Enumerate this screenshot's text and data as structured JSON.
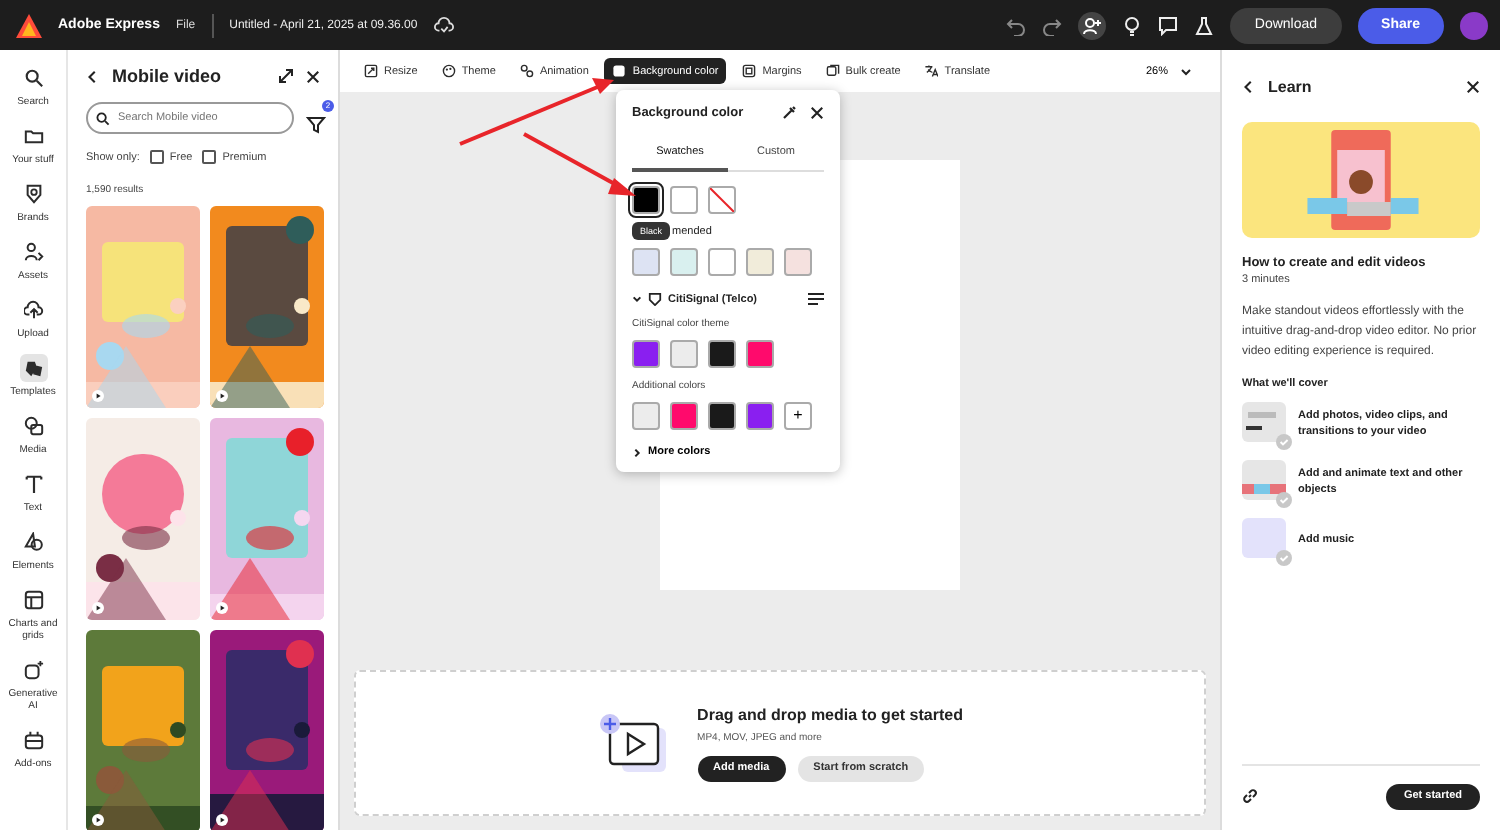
{
  "app_bar": {
    "app_name": "Adobe Express",
    "menu": "File",
    "doc_title": "Untitled - April 21, 2025 at 09.36.00",
    "buttons": [
      {
        "label": "Download",
        "kind": "secondary"
      },
      {
        "label": "Share",
        "kind": "primary"
      }
    ]
  },
  "rail": [
    {
      "label": "Search",
      "selected": false
    },
    {
      "label": "Your stuff",
      "selected": false
    },
    {
      "label": "Brands",
      "selected": false
    },
    {
      "label": "Assets",
      "selected": false
    },
    {
      "label": "Upload",
      "selected": false
    },
    {
      "label": "Templates",
      "selected": true
    },
    {
      "label": "Media",
      "selected": false
    },
    {
      "label": "Text",
      "selected": false
    },
    {
      "label": "Elements",
      "selected": false
    },
    {
      "label": "Charts and grids",
      "selected": false
    },
    {
      "label": "Generative AI",
      "selected": false
    },
    {
      "label": "Add-ons",
      "selected": false
    }
  ],
  "panel": {
    "title": "Mobile video",
    "search": {
      "placeholder": "Search Mobile video"
    },
    "filter_badge": "2",
    "show_only": "Show only:",
    "filters": [
      {
        "label": "Free",
        "checked": false
      },
      {
        "label": "Premium",
        "checked": false
      }
    ],
    "results": "1,590 results"
  },
  "toolbar": {
    "tools": [
      {
        "label": "Resize",
        "selected": false
      },
      {
        "label": "Theme",
        "selected": false
      },
      {
        "label": "Animation",
        "selected": false
      },
      {
        "label": "Background color",
        "selected": true
      },
      {
        "label": "Margins",
        "selected": false
      },
      {
        "label": "Bulk create",
        "selected": false
      },
      {
        "label": "Translate",
        "selected": false
      }
    ],
    "zoom": "26%"
  },
  "popover": {
    "title": "Background color",
    "tabs": [
      {
        "label": "Swatches",
        "selected": true
      },
      {
        "label": "Custom",
        "selected": false
      }
    ],
    "swatches": [
      {
        "kind": "color",
        "color": "#000000",
        "selected": true
      },
      {
        "kind": "color",
        "color": "#ffffff",
        "selected": false
      },
      {
        "kind": "none",
        "selected": false
      }
    ],
    "tooltip": "Black",
    "recommended_label": "mended",
    "recommended": [
      {
        "color": "#dde3f3"
      },
      {
        "color": "#d9f0ef"
      },
      {
        "color": "#ffffff"
      },
      {
        "color": "#f1ecda"
      },
      {
        "color": "#f5e1df"
      }
    ],
    "brand": {
      "name": "CitiSignal (Telco)",
      "expanded": true,
      "theme_label": "CitiSignal color theme",
      "theme_colors": [
        {
          "color": "#8a1ff0"
        },
        {
          "color": "#ececec"
        },
        {
          "color": "#1a1a1a"
        },
        {
          "color": "#ff0a6c"
        }
      ],
      "additional_label": "Additional colors",
      "additional_colors": [
        {
          "color": "#ececec"
        },
        {
          "color": "#ff0a6c"
        },
        {
          "color": "#1a1a1a"
        },
        {
          "color": "#8a1ff0"
        }
      ],
      "add": "+"
    },
    "more": "More colors"
  },
  "drop_zone": {
    "title": "Drag and drop media to get started",
    "subtitle": "MP4, MOV, JPEG and more",
    "buttons": [
      {
        "label": "Add media",
        "kind": "primary"
      },
      {
        "label": "Start from scratch",
        "kind": "secondary"
      }
    ]
  },
  "learn": {
    "title": "Learn",
    "heading": "How to create and edit videos",
    "duration": "3 minutes",
    "description": "Make standout videos effortlessly with the intuitive drag-and-drop video editor. No prior video editing experience is required.",
    "cover_label": "What we'll cover",
    "items": [
      {
        "text": "Add photos, video clips, and transitions to your video"
      },
      {
        "text": "Add and animate text and other objects"
      },
      {
        "text": "Add music"
      }
    ],
    "button": "Get started"
  }
}
